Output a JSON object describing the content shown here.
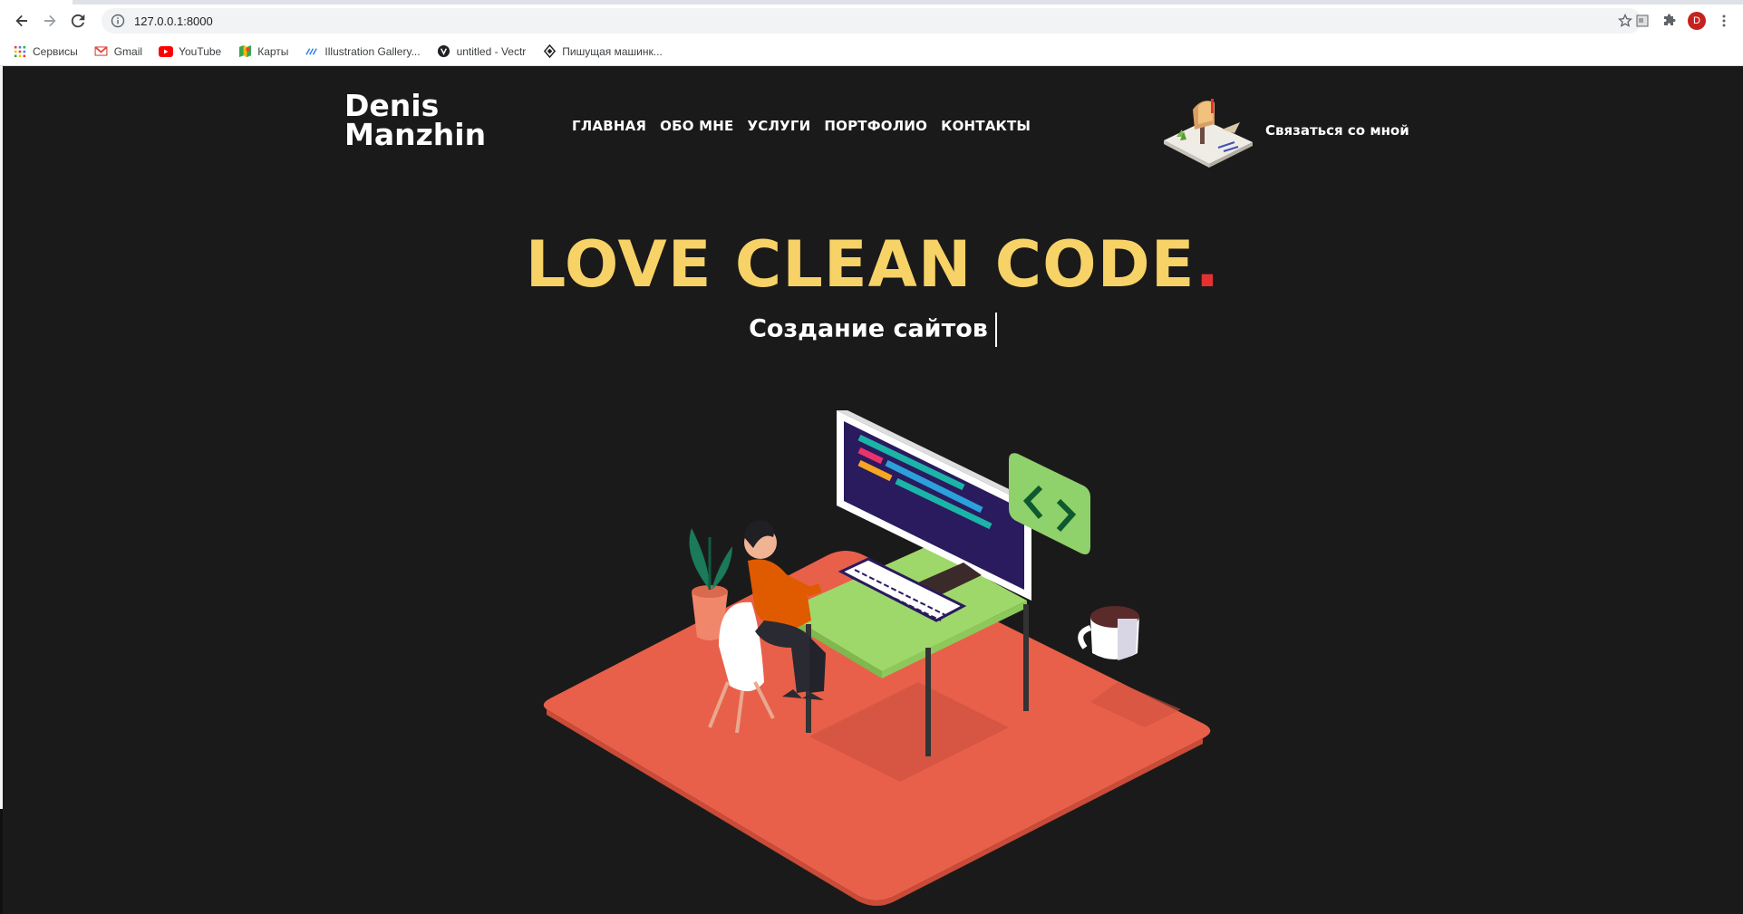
{
  "browser": {
    "url": "127.0.0.1:8000",
    "avatar_letter": "D",
    "bookmarks": [
      {
        "label": "Сервисы",
        "icon": "apps-grid-icon"
      },
      {
        "label": "Gmail",
        "icon": "gmail-icon"
      },
      {
        "label": "YouTube",
        "icon": "youtube-icon"
      },
      {
        "label": "Карты",
        "icon": "maps-icon"
      },
      {
        "label": "Illustration Gallery...",
        "icon": "illustration-gallery-icon"
      },
      {
        "label": "untitled - Vectr",
        "icon": "vectr-icon"
      },
      {
        "label": "Пишущая машинк...",
        "icon": "typewriter-icon"
      }
    ]
  },
  "site": {
    "logo_line1": "Denis",
    "logo_line2": "Manzhin",
    "nav": [
      "ГЛАВНАЯ",
      "ОБО МНЕ",
      "УСЛУГИ",
      "ПОРТФОЛИО",
      "КОНТАКТЫ"
    ],
    "contact_label": "Связаться со мной",
    "hero_title": "LOVE CLEAN CODE",
    "hero_title_dot": ".",
    "hero_subtitle": "Создание сайтов"
  },
  "colors": {
    "page_bg": "#1b1a1a",
    "title_yellow": "#f7d267",
    "accent_red": "#e63131",
    "floor_coral": "#e8604a",
    "desk_green": "#9fd86a"
  }
}
